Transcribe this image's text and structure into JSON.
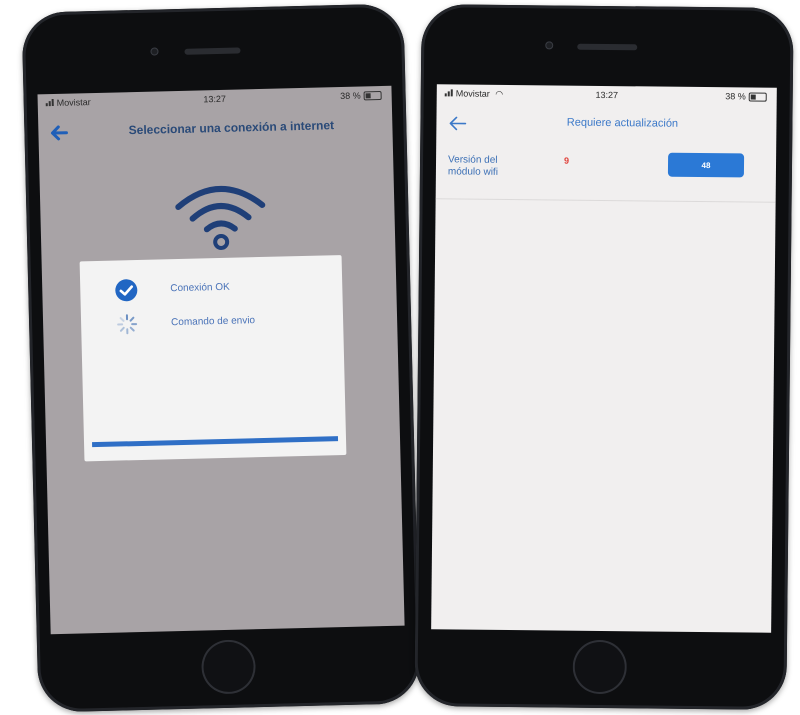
{
  "left_phone": {
    "status": {
      "carrier": "Movistar",
      "time": "13:27",
      "battery": "38 %"
    },
    "nav": {
      "title": "Seleccionar una conexión a internet"
    },
    "dialog": {
      "items": [
        {
          "label": "Conexión OK",
          "icon": "check-circle-icon"
        },
        {
          "label": "Comando de envio",
          "icon": "spinner-icon"
        }
      ],
      "progress": 1.0
    }
  },
  "right_phone": {
    "status": {
      "carrier": "Movistar",
      "time": "13:27",
      "battery": "38 %"
    },
    "nav": {
      "title": "Requiere actualización"
    },
    "version": {
      "label": "Versión del módulo wifi",
      "current": "9",
      "button": "48"
    }
  },
  "colors": {
    "accent": "#2f6fc6",
    "title_dark_blue": "#2a4a78",
    "version_red": "#e0413a",
    "screen_gray": "#a8a3a6"
  }
}
